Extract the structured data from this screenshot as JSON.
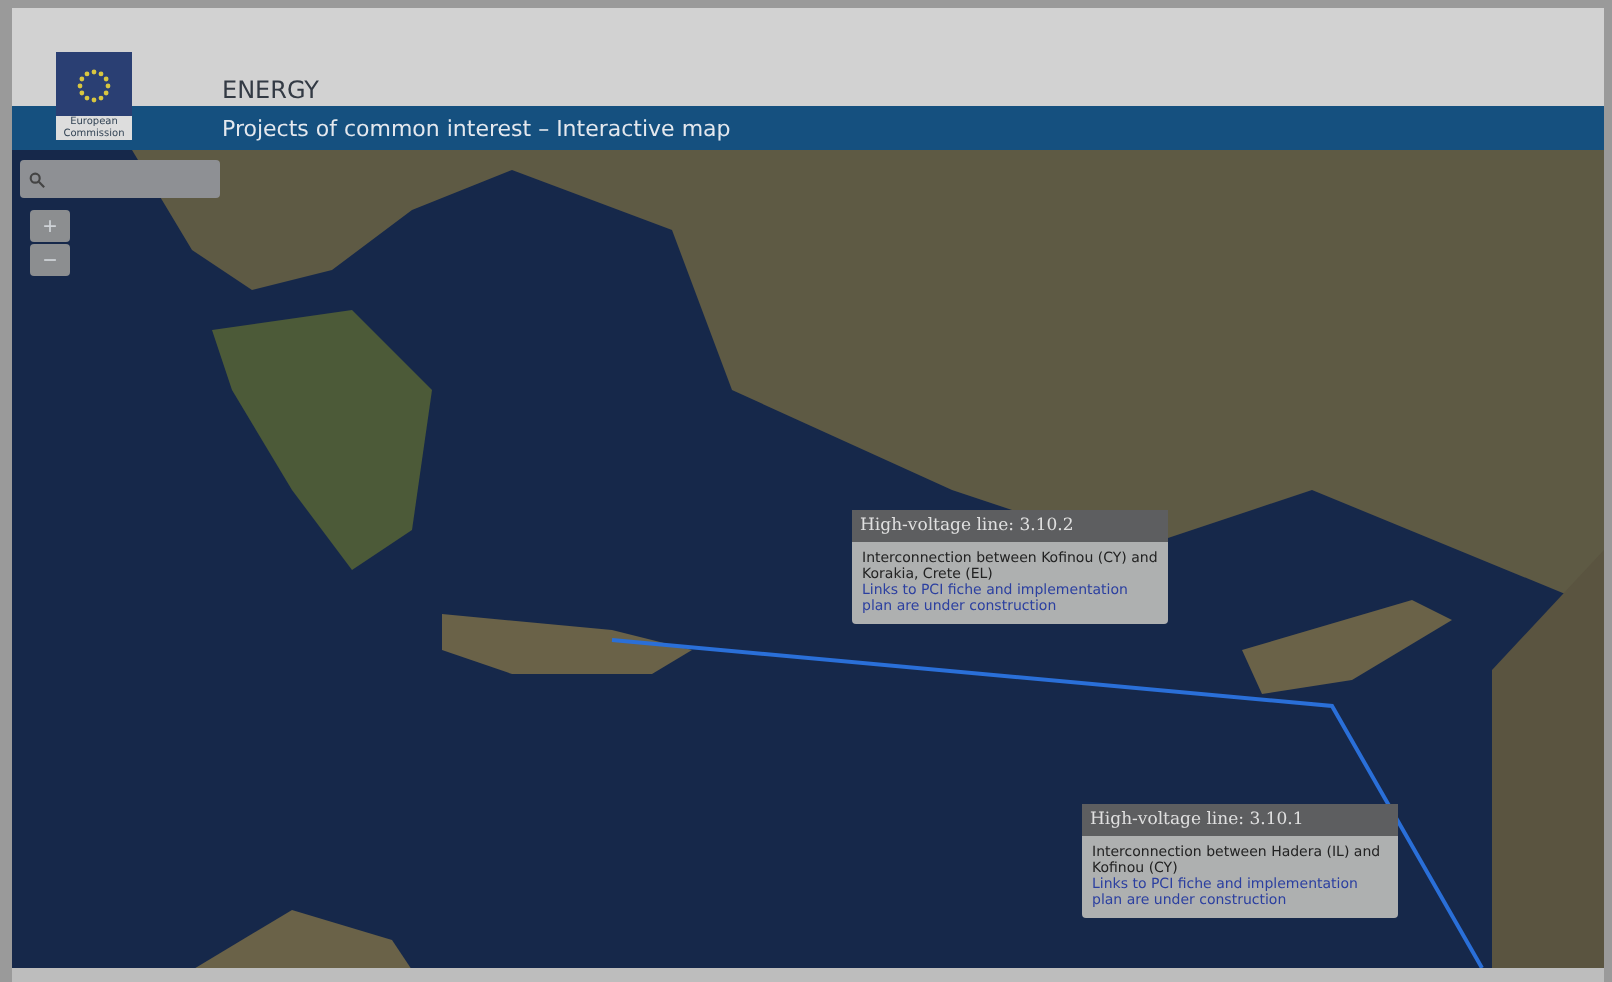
{
  "header": {
    "logo_text": "European Commission",
    "section": "ENERGY",
    "title": "Projects of common interest – Interactive map"
  },
  "map": {
    "zoom_in": "+",
    "zoom_out": "−",
    "popups": [
      {
        "title": "High-voltage line: 3.10.2",
        "description": "Interconnection between Kofinou (CY) and Korakia, Crete (EL)",
        "link": "Links to PCI fiche and implementation plan are under construction"
      },
      {
        "title": "High-voltage line: 3.10.1",
        "description": "Interconnection between Hadera (IL) and Kofinou (CY)",
        "link": "Links to PCI fiche and implementation plan are under construction"
      }
    ]
  }
}
